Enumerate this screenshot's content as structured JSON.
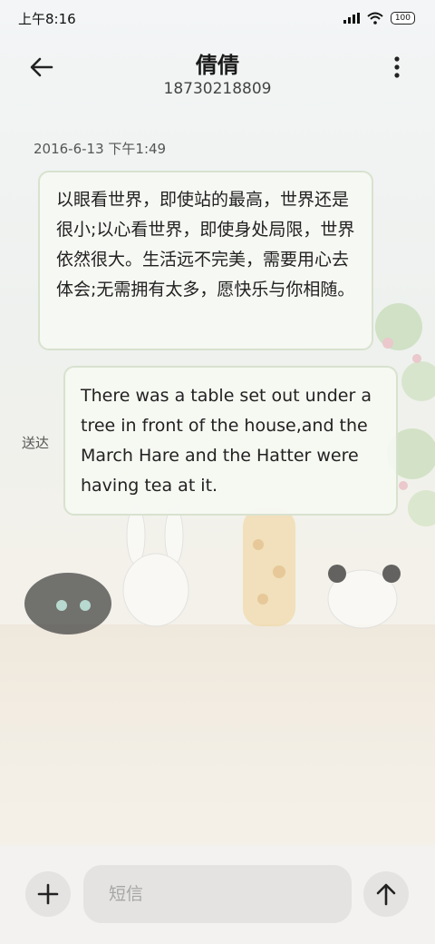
{
  "status_bar": {
    "time": "上午8:16",
    "battery": "100"
  },
  "header": {
    "contact_name": "倩倩",
    "contact_number": "18730218809"
  },
  "conversation": {
    "timestamp": "2016-6-13 下午1:49",
    "incoming_message": "以眼看世界，即使站的最高，世界还是很小;以心看世界，即使身处局限，世界依然很大。生活远不完美，需要用心去体会;无需拥有太多，愿快乐与你相随。",
    "outgoing_message": "There was a table set out under a tree in front of the house,and the March Hare and the Hatter were having tea at it.",
    "delivery_status": "送达"
  },
  "composer": {
    "placeholder": "短信",
    "value": ""
  },
  "icons": {
    "back": "arrow-left-icon",
    "more": "more-vertical-icon",
    "add": "plus-icon",
    "send": "arrow-up-icon"
  }
}
